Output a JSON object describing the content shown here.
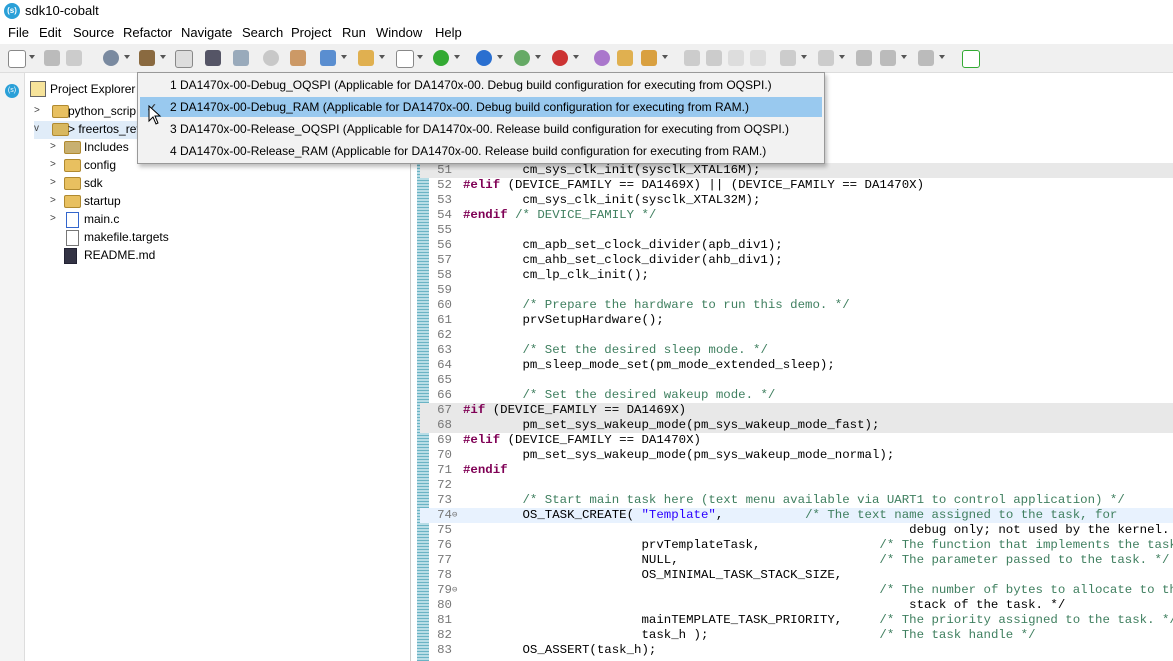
{
  "window": {
    "title": "sdk10-cobalt"
  },
  "menu": [
    "File",
    "Edit",
    "Source",
    "Refactor",
    "Navigate",
    "Search",
    "Project",
    "Run",
    "Window",
    "Help"
  ],
  "project_explorer": {
    "title": "Project Explorer",
    "items": [
      {
        "label": "python_scrip",
        "indent": 0,
        "twist": ">",
        "icon": "project-icon"
      },
      {
        "label": "> freertos_ret",
        "indent": 0,
        "twist": "v",
        "icon": "c-project-icon"
      },
      {
        "label": "Includes",
        "indent": 1,
        "twist": ">",
        "icon": "includes-icon"
      },
      {
        "label": "config",
        "indent": 1,
        "twist": ">",
        "icon": "folder-icon"
      },
      {
        "label": "sdk",
        "indent": 1,
        "twist": ">",
        "icon": "folder-icon"
      },
      {
        "label": "startup",
        "indent": 1,
        "twist": ">",
        "icon": "folder-icon"
      },
      {
        "label": "main.c",
        "indent": 1,
        "twist": ">",
        "icon": "c-file-icon"
      },
      {
        "label": "makefile.targets",
        "indent": 1,
        "twist": "",
        "icon": "file-icon"
      },
      {
        "label": "README.md",
        "indent": 1,
        "twist": "",
        "icon": "md-file-icon"
      }
    ]
  },
  "build_configs": {
    "selected_index": 1,
    "items": [
      "1 DA1470x-00-Debug_OQSPI (Applicable for DA1470x-00. Debug build configuration for executing from OQSPI.)",
      "2 DA1470x-00-Debug_RAM (Applicable for DA1470x-00. Debug build configuration for executing from RAM.)",
      "3 DA1470x-00-Release_OQSPI (Applicable for DA1470x-00. Release build configuration for executing from OQSPI.)",
      "4 DA1470x-00-Release_RAM (Applicable for DA1470x-00. Release build configuration for executing from RAM.)"
    ]
  },
  "editor": {
    "lines": [
      {
        "n": "51",
        "hl": "hl",
        "fold": "",
        "code": "        cm_sys_clk_init(sysclk_XTAL16M);"
      },
      {
        "n": "52",
        "hl": "",
        "fold": "",
        "code": "#elif (DEVICE_FAMILY == DA1469X) || (DEVICE_FAMILY == DA1470X)"
      },
      {
        "n": "53",
        "hl": "",
        "fold": "",
        "code": "        cm_sys_clk_init(sysclk_XTAL32M);"
      },
      {
        "n": "54",
        "hl": "",
        "fold": "",
        "code": "#endif /* DEVICE_FAMILY */"
      },
      {
        "n": "55",
        "hl": "",
        "fold": "",
        "code": ""
      },
      {
        "n": "56",
        "hl": "",
        "fold": "",
        "code": "        cm_apb_set_clock_divider(apb_div1);"
      },
      {
        "n": "57",
        "hl": "",
        "fold": "",
        "code": "        cm_ahb_set_clock_divider(ahb_div1);"
      },
      {
        "n": "58",
        "hl": "",
        "fold": "",
        "code": "        cm_lp_clk_init();"
      },
      {
        "n": "59",
        "hl": "",
        "fold": "",
        "code": ""
      },
      {
        "n": "60",
        "hl": "",
        "fold": "",
        "code": "        /* Prepare the hardware to run this demo. */"
      },
      {
        "n": "61",
        "hl": "",
        "fold": "",
        "code": "        prvSetupHardware();"
      },
      {
        "n": "62",
        "hl": "",
        "fold": "",
        "code": ""
      },
      {
        "n": "63",
        "hl": "",
        "fold": "",
        "code": "        /* Set the desired sleep mode. */"
      },
      {
        "n": "64",
        "hl": "",
        "fold": "",
        "code": "        pm_sleep_mode_set(pm_mode_extended_sleep);"
      },
      {
        "n": "65",
        "hl": "",
        "fold": "",
        "code": ""
      },
      {
        "n": "66",
        "hl": "",
        "fold": "",
        "code": "        /* Set the desired wakeup mode. */"
      },
      {
        "n": "67",
        "hl": "hl",
        "fold": "",
        "code": "#if (DEVICE_FAMILY == DA1469X)"
      },
      {
        "n": "68",
        "hl": "hl",
        "fold": "",
        "code": "        pm_set_sys_wakeup_mode(pm_sys_wakeup_mode_fast);"
      },
      {
        "n": "69",
        "hl": "",
        "fold": "",
        "code": "#elif (DEVICE_FAMILY == DA1470X)"
      },
      {
        "n": "70",
        "hl": "",
        "fold": "",
        "code": "        pm_set_sys_wakeup_mode(pm_sys_wakeup_mode_normal);"
      },
      {
        "n": "71",
        "hl": "",
        "fold": "",
        "code": "#endif"
      },
      {
        "n": "72",
        "hl": "",
        "fold": "",
        "code": ""
      },
      {
        "n": "73",
        "hl": "",
        "fold": "",
        "code": "        /* Start main task here (text menu available via UART1 to control application) */"
      },
      {
        "n": "74",
        "hl": "cur",
        "fold": "⊖",
        "code": "        OS_TASK_CREATE( \"Template\",           /* The text name assigned to the task, for"
      },
      {
        "n": "75",
        "hl": "",
        "fold": "",
        "code": "                                                            debug only; not used by the kernel. */"
      },
      {
        "n": "76",
        "hl": "",
        "fold": "",
        "code": "                        prvTemplateTask,                /* The function that implements the task. */"
      },
      {
        "n": "77",
        "hl": "",
        "fold": "",
        "code": "                        NULL,                           /* The parameter passed to the task. */"
      },
      {
        "n": "78",
        "hl": "",
        "fold": "",
        "code": "                        OS_MINIMAL_TASK_STACK_SIZE,"
      },
      {
        "n": "79",
        "hl": "",
        "fold": "⊖",
        "code": "                                                        /* The number of bytes to allocate to the"
      },
      {
        "n": "80",
        "hl": "",
        "fold": "",
        "code": "                                                            stack of the task. */"
      },
      {
        "n": "81",
        "hl": "",
        "fold": "",
        "code": "                        mainTEMPLATE_TASK_PRIORITY,     /* The priority assigned to the task. */"
      },
      {
        "n": "82",
        "hl": "",
        "fold": "",
        "code": "                        task_h );                       /* The task handle */"
      },
      {
        "n": "83",
        "hl": "",
        "fold": "",
        "code": "        OS_ASSERT(task_h);"
      }
    ]
  }
}
